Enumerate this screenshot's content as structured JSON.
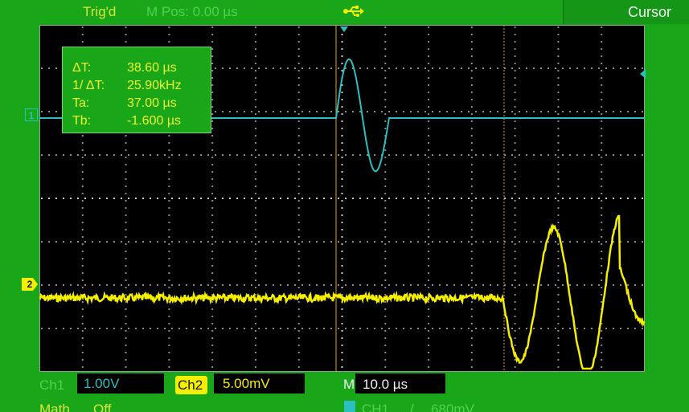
{
  "header": {
    "trigger_status": "Trig'd",
    "m_pos": "M Pos: 0.00 µs",
    "usb_icon": "usb-icon",
    "menu_title": "Cursor"
  },
  "cursor_readout": {
    "rows": [
      {
        "label": "ΔT:",
        "value": "38.60 µs"
      },
      {
        "label": "1/ ΔT:",
        "value": "25.90kHz"
      },
      {
        "label": "Ta:",
        "value": "37.00 µs"
      },
      {
        "label": "Tb:",
        "value": "-1.600 µs"
      }
    ]
  },
  "markers": {
    "ch1": "1",
    "ch2": "2"
  },
  "footer": {
    "ch1_label": "Ch1",
    "ch1_scale": "1.00V",
    "ch2_label": "Ch2",
    "ch2_scale": "5.00mV",
    "m_label": "M",
    "m_scale": "10.0 µs",
    "math_label": "Math",
    "math_state": "Off",
    "trigger_source": "CH1",
    "trigger_slope": "/",
    "trigger_level": "680mV"
  },
  "colors": {
    "background": "#19a619",
    "screen": "#000000",
    "ch1": "#2bbfbf",
    "ch2": "#f4ee00",
    "cursor": "#e6a21e",
    "text": "#d9e640"
  }
}
